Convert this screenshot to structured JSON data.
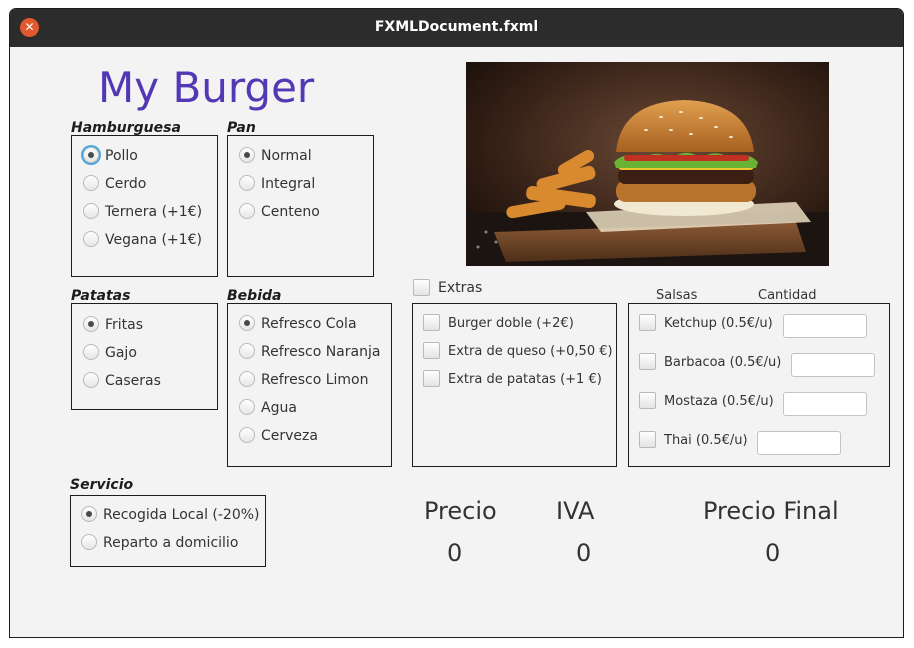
{
  "window": {
    "title": "FXMLDocument.fxml"
  },
  "app": {
    "title": "My Burger"
  },
  "hamburguesa": {
    "label": "Hamburguesa",
    "options": [
      "Pollo",
      "Cerdo",
      "Ternera (+1€)",
      "Vegana (+1€)"
    ],
    "selected": "Pollo"
  },
  "pan": {
    "label": "Pan",
    "options": [
      "Normal",
      "Integral",
      "Centeno"
    ],
    "selected": "Normal"
  },
  "patatas": {
    "label": "Patatas",
    "options": [
      "Fritas",
      "Gajo",
      "Caseras"
    ],
    "selected": "Fritas"
  },
  "bebida": {
    "label": "Bebida",
    "options": [
      "Refresco Cola",
      "Refresco Naranja",
      "Refresco Limon",
      "Agua",
      "Cerveza"
    ],
    "selected": "Refresco Cola"
  },
  "servicio": {
    "label": "Servicio",
    "options": [
      "Recogida Local (-20%)",
      "Reparto a domicilio"
    ],
    "selected": "Recogida Local (-20%)"
  },
  "extras": {
    "label": "Extras",
    "checked": false,
    "options": [
      "Burger doble (+2€)",
      "Extra de queso (+0,50 €)",
      "Extra de patatas (+1 €)"
    ]
  },
  "salsas": {
    "label": "Salsas",
    "cantidad_label": "Cantidad",
    "items": [
      {
        "name": "Ketchup (0.5€/u)",
        "value": ""
      },
      {
        "name": "Barbacoa (0.5€/u)",
        "value": ""
      },
      {
        "name": "Mostaza (0.5€/u)",
        "value": ""
      },
      {
        "name": "Thai (0.5€/u)",
        "value": ""
      }
    ]
  },
  "totals": {
    "precio_label": "Precio",
    "precio_value": "0",
    "iva_label": "IVA",
    "iva_value": "0",
    "final_label": "Precio Final",
    "final_value": "0"
  }
}
